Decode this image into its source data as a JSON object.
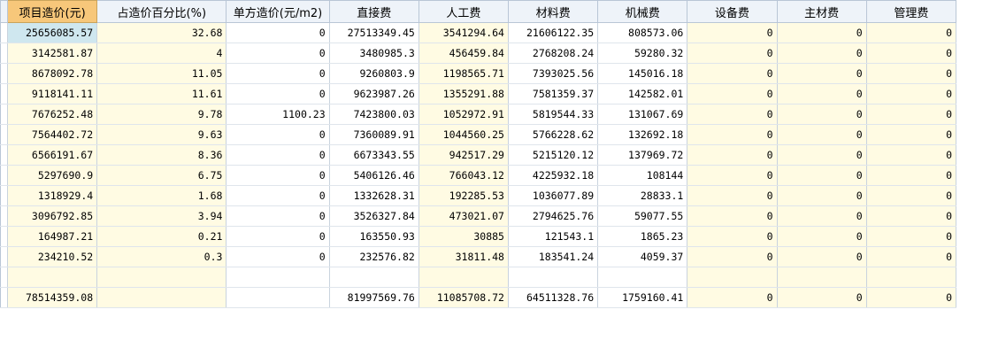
{
  "columns": [
    "项目造价(元)",
    "占造价百分比(%)",
    "单方造价(元/m2)",
    "直接费",
    "人工费",
    "材料费",
    "机械费",
    "设备费",
    "主材费",
    "管理费"
  ],
  "rows": [
    [
      "25656085.57",
      "32.68",
      "0",
      "27513349.45",
      "3541294.64",
      "21606122.35",
      "808573.06",
      "0",
      "0",
      "0"
    ],
    [
      "3142581.87",
      "4",
      "0",
      "3480985.3",
      "456459.84",
      "2768208.24",
      "59280.32",
      "0",
      "0",
      "0"
    ],
    [
      "8678092.78",
      "11.05",
      "0",
      "9260803.9",
      "1198565.71",
      "7393025.56",
      "145016.18",
      "0",
      "0",
      "0"
    ],
    [
      "9118141.11",
      "11.61",
      "0",
      "9623987.26",
      "1355291.88",
      "7581359.37",
      "142582.01",
      "0",
      "0",
      "0"
    ],
    [
      "7676252.48",
      "9.78",
      "1100.23",
      "7423800.03",
      "1052972.91",
      "5819544.33",
      "131067.69",
      "0",
      "0",
      "0"
    ],
    [
      "7564402.72",
      "9.63",
      "0",
      "7360089.91",
      "1044560.25",
      "5766228.62",
      "132692.18",
      "0",
      "0",
      "0"
    ],
    [
      "6566191.67",
      "8.36",
      "0",
      "6673343.55",
      "942517.29",
      "5215120.12",
      "137969.72",
      "0",
      "0",
      "0"
    ],
    [
      "5297690.9",
      "6.75",
      "0",
      "5406126.46",
      "766043.12",
      "4225932.18",
      "108144",
      "0",
      "0",
      "0"
    ],
    [
      "1318929.4",
      "1.68",
      "0",
      "1332628.31",
      "192285.53",
      "1036077.89",
      "28833.1",
      "0",
      "0",
      "0"
    ],
    [
      "3096792.85",
      "3.94",
      "0",
      "3526327.84",
      "473021.07",
      "2794625.76",
      "59077.55",
      "0",
      "0",
      "0"
    ],
    [
      "164987.21",
      "0.21",
      "0",
      "163550.93",
      "30885",
      "121543.1",
      "1865.23",
      "0",
      "0",
      "0"
    ],
    [
      "234210.52",
      "0.3",
      "0",
      "232576.82",
      "31811.48",
      "183541.24",
      "4059.37",
      "0",
      "0",
      "0"
    ],
    [
      "",
      "",
      "",
      "",
      "",
      "",
      "",
      "",
      "",
      ""
    ],
    [
      "78514359.08",
      "",
      "",
      "81997569.76",
      "11085708.72",
      "64511328.76",
      "1759160.41",
      "0",
      "0",
      "0"
    ]
  ],
  "colors": {
    "header_selected": "#f7c77a",
    "cell_selected": "#cfe7ef",
    "row_cream": "#fffbe3",
    "grid": "#c9d3de"
  }
}
